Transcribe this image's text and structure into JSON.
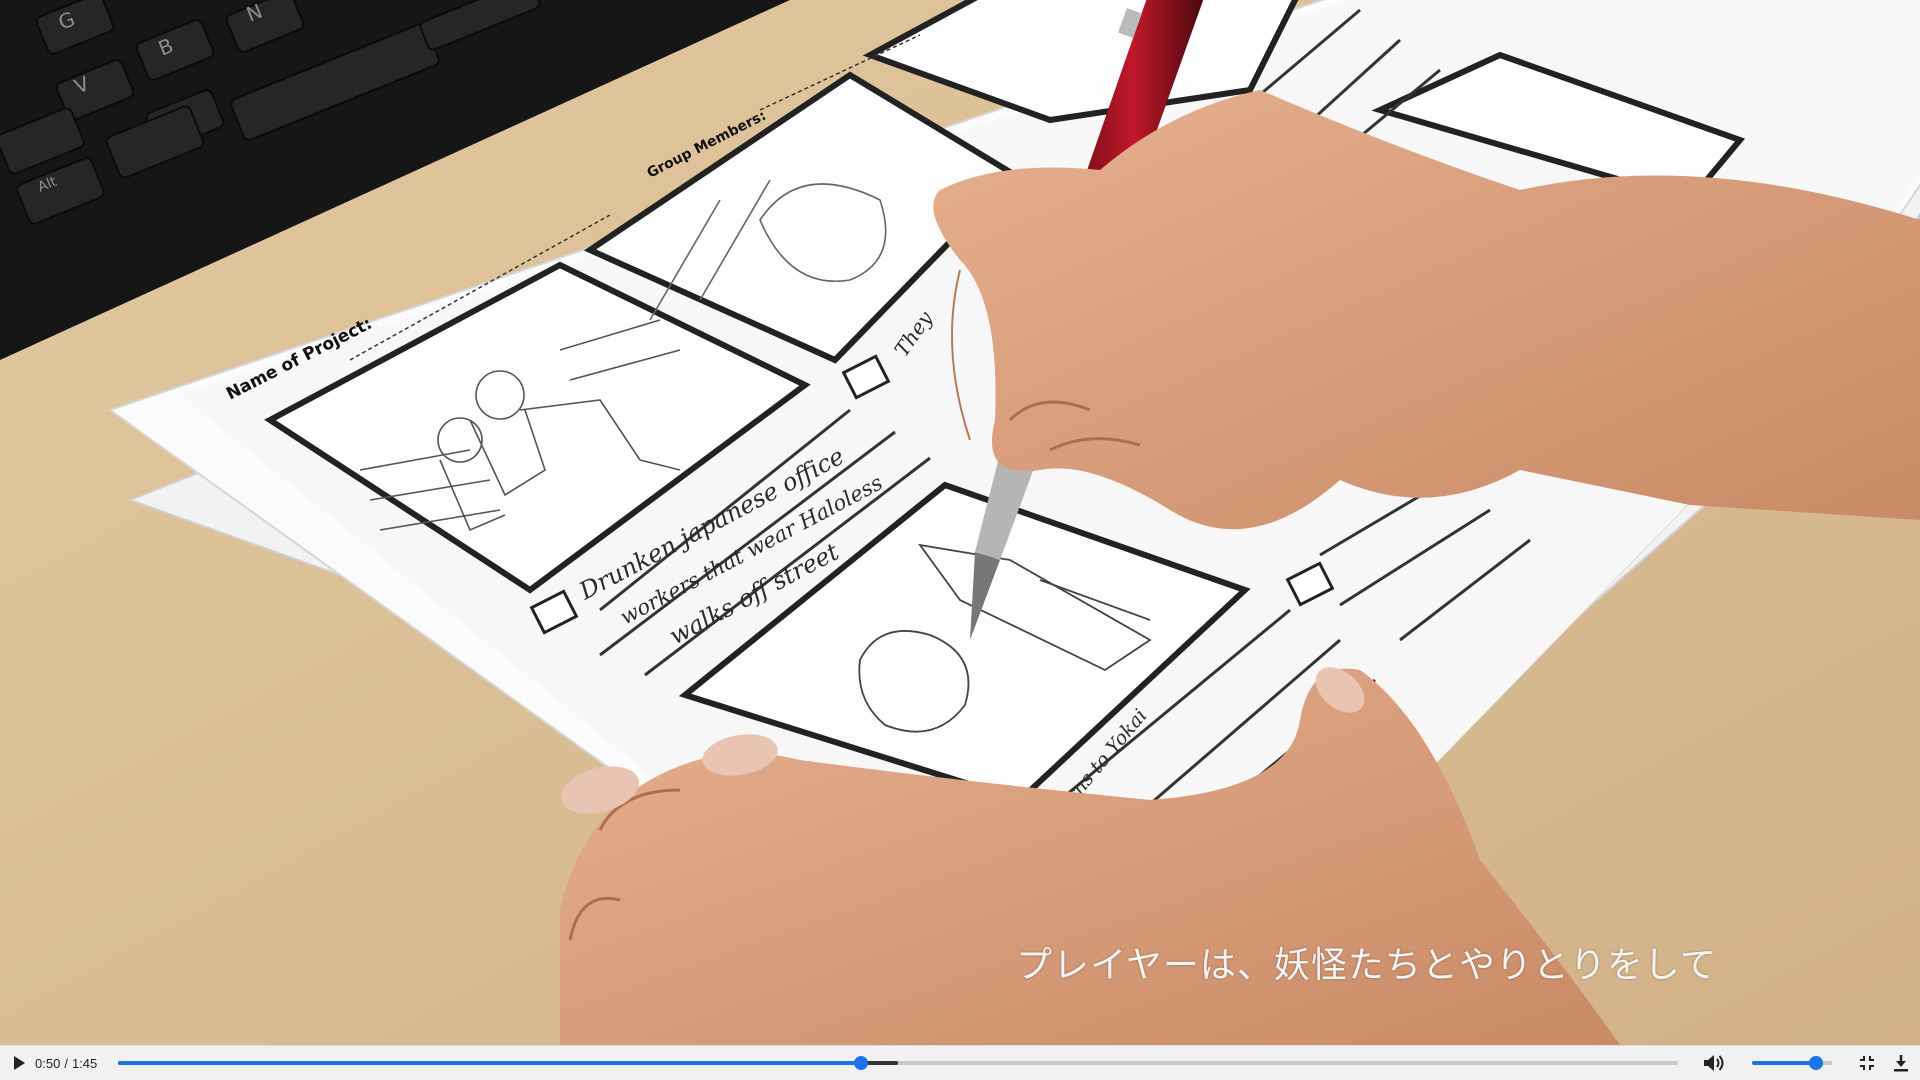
{
  "player": {
    "current_time": "0:50",
    "separator": "/",
    "duration": "1:45",
    "progress": 0.4762,
    "buffered": 0.5,
    "volume": 0.8,
    "accent_color": "#1a73e8"
  },
  "subtitle": {
    "text": "プレイヤーは、妖怪たちとやりとりをして"
  },
  "scene": {
    "keyboard_keys": [
      "G",
      "B",
      "V",
      "N",
      "Alt"
    ],
    "sheet_labels": {
      "project": "Name of Project:",
      "members": "Group Members:"
    },
    "handwriting": {
      "panel1_line1": "Drunken japanese office",
      "panel1_line2": "workers that wear Haloless",
      "panel1_line3": "walks off street",
      "panel2_fragment": "They",
      "panel3_fragment": "turns to Yokai"
    }
  },
  "icons": {
    "play": "play-icon",
    "volume": "volume-icon",
    "fullscreen": "fullscreen-icon",
    "download": "download-icon"
  }
}
